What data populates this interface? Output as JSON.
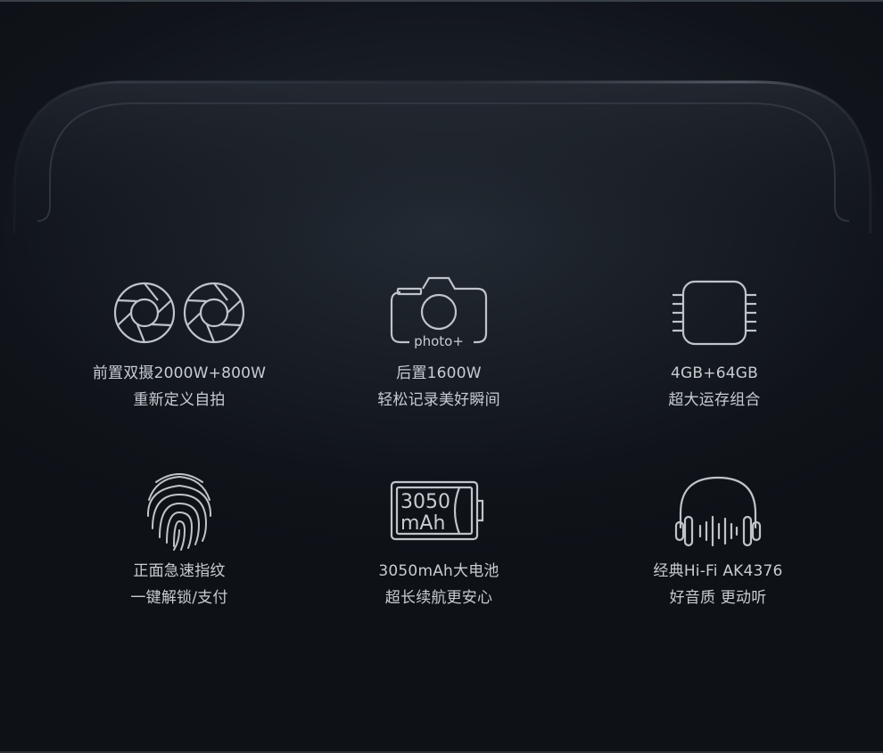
{
  "features": [
    {
      "icon": "dual-aperture-icon",
      "line1": "前置双摄2000W+800W",
      "line2": "重新定义自拍"
    },
    {
      "icon": "camera-icon",
      "icon_text": "photo+",
      "line1": "后置1600W",
      "line2": "轻松记录美好瞬间"
    },
    {
      "icon": "chip-icon",
      "line1": "4GB+64GB",
      "line2": "超大运存组合"
    },
    {
      "icon": "fingerprint-icon",
      "line1": "正面急速指纹",
      "line2": "一键解锁/支付"
    },
    {
      "icon": "battery-icon",
      "icon_text_1": "3050",
      "icon_text_2": "mAh",
      "line1": "3050mAh大电池",
      "line2": "超长续航更安心"
    },
    {
      "icon": "headphones-icon",
      "line1": "经典Hi-Fi AK4376",
      "line2": "好音质 更动听"
    }
  ],
  "colors": {
    "background": "#0f1318",
    "text": "#c7ccd2",
    "icon_stroke": "#bfc4ca"
  }
}
